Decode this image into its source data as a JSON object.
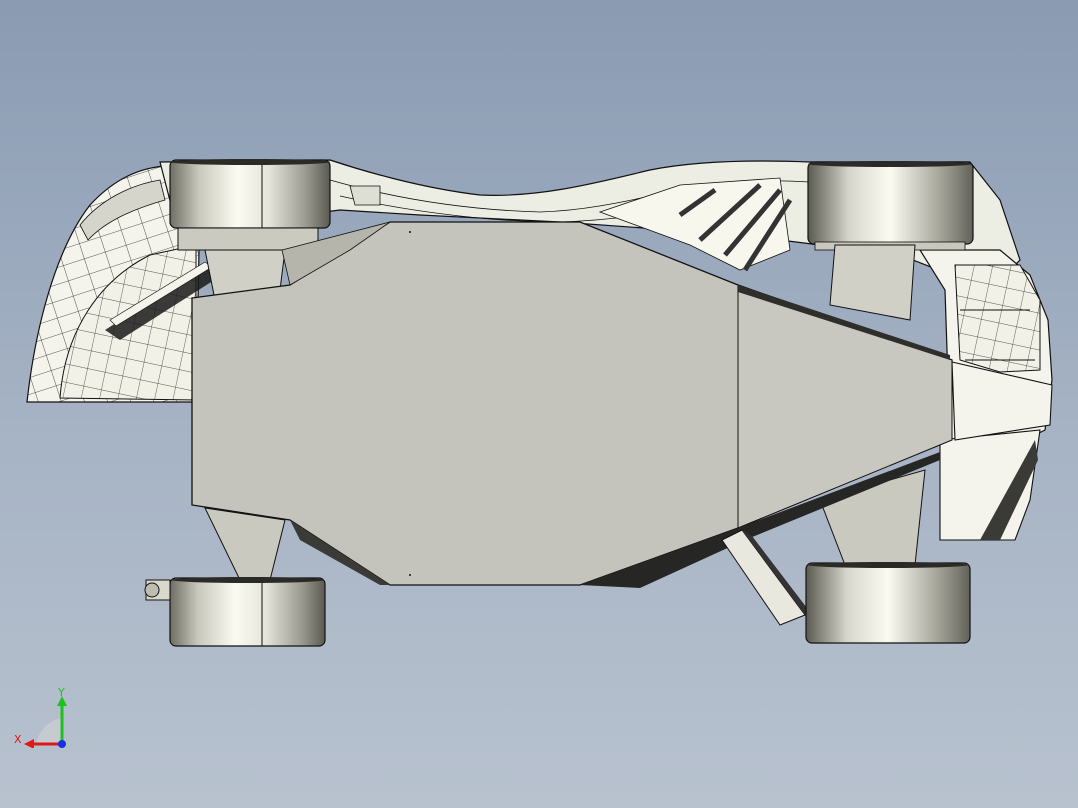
{
  "viewport": {
    "background_top": "#8a9bb2",
    "background_bottom": "#b8c2cf"
  },
  "model": {
    "body_color": "#c4c4bc",
    "body_light": "#f3f3ea",
    "edge_color": "#141414",
    "shadow_color": "#2a2a2a"
  },
  "triad": {
    "x_label": "X",
    "y_label": "Y",
    "x_color": "#e01818",
    "y_color": "#20c020",
    "z_color": "#1830e0"
  }
}
